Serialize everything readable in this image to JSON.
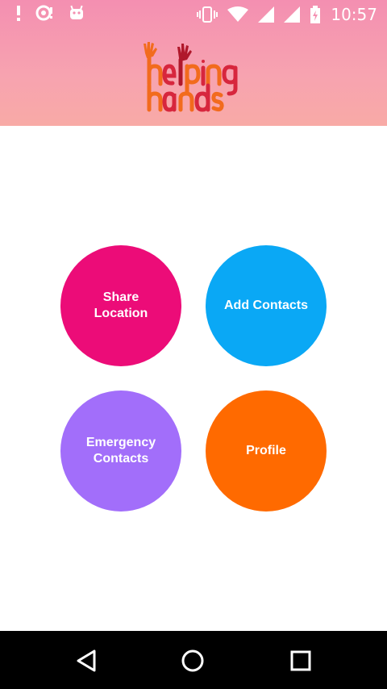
{
  "status_bar": {
    "time": "10:57",
    "icons_left": [
      "alert-icon",
      "sync-icon",
      "android-icon"
    ],
    "icons_right": [
      "vibrate-icon",
      "wifi-icon",
      "signal-icon",
      "signal-icon-2",
      "battery-charging-icon"
    ]
  },
  "header": {
    "logo_text": "helping hands",
    "colors": {
      "background_top": "#f48fb1",
      "background_bottom": "#f8aaa6",
      "logo_orange": "#f26b1d",
      "logo_red": "#d7263d"
    }
  },
  "menu": {
    "share_location": "Share Location",
    "add_contacts": "Add Contacts",
    "emergency_contacts": "Emergency Contacts",
    "profile": "Profile",
    "colors": {
      "share": "#ec0c78",
      "add": "#0aa8f5",
      "emergency": "#a26efa",
      "profile": "#ff6a00"
    }
  },
  "nav_bar": {
    "icons": [
      "back-icon",
      "home-icon",
      "recents-icon"
    ]
  }
}
